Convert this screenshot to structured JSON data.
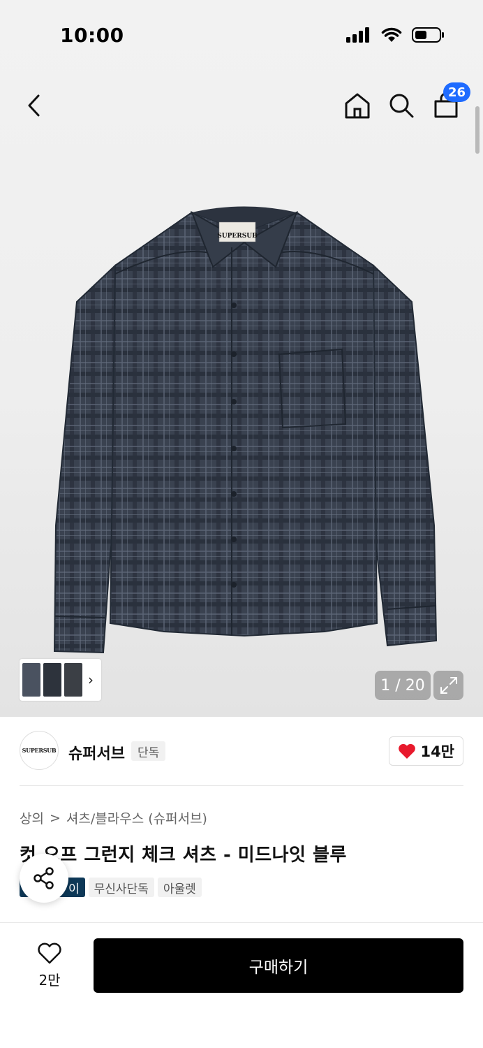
{
  "status": {
    "time": "10:00"
  },
  "nav": {
    "cart_count": "26"
  },
  "gallery": {
    "page_indicator": "1 / 20",
    "shirt_label_text": "SUPERSUB"
  },
  "brand": {
    "logo_text": "SUPERSUB",
    "name": "슈퍼서브",
    "tag": "단독",
    "likes": "14만"
  },
  "breadcrumb": {
    "level1": "상의",
    "separator": ">",
    "level2": "셔츠/블라우스 (슈퍼서브)"
  },
  "product": {
    "title": "컷 오프 그런지 체크 셔츠 - 미드나잇 블루",
    "tags": [
      "이",
      "무신사단독",
      "아울렛"
    ]
  },
  "bottom": {
    "wish_count": "2만",
    "buy_label": "구매하기"
  },
  "colors": {
    "accent_blue": "#1e6bff",
    "heart_red": "#e8192c",
    "buy_black": "#000000",
    "tag_dark": "#0d3857"
  },
  "icons": [
    "back-icon",
    "home-icon",
    "search-icon",
    "cart-icon",
    "expand-icon",
    "heart-icon",
    "heart-outline-icon",
    "share-icon",
    "chevron-right-icon"
  ]
}
